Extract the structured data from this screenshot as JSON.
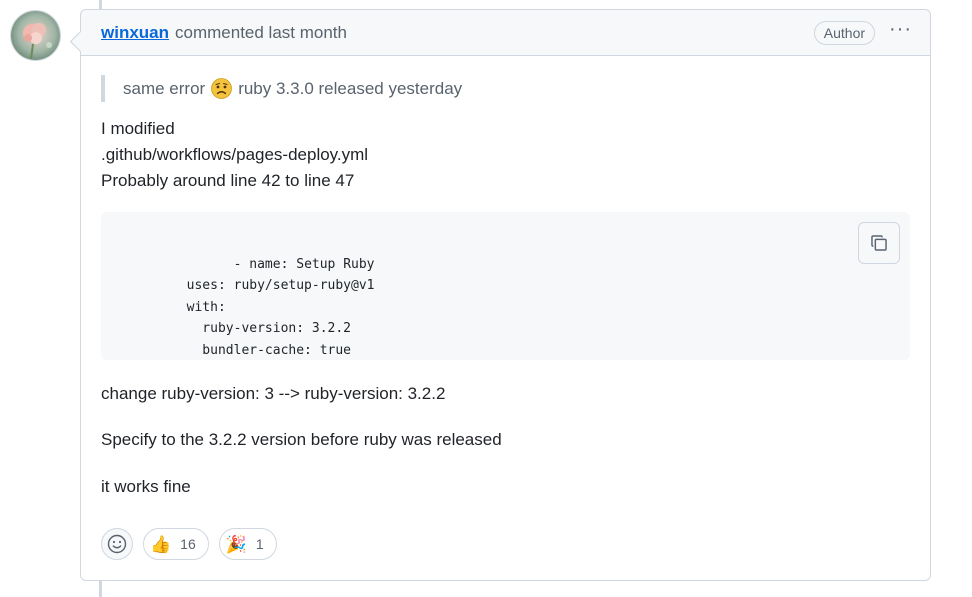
{
  "comment": {
    "author": "winxuan",
    "meta": "commented last month",
    "role_badge": "Author",
    "more_label": "···",
    "quote": {
      "before": "same error",
      "emoji": "sad-face-emoji",
      "after": "ruby 3.3.0 released yesterday"
    },
    "lines": [
      "I modified",
      ".github/workflows/pages-deploy.yml",
      "Probably around line 42 to line 47"
    ],
    "code": "- name: Setup Ruby\n  uses: ruby/setup-ruby@v1\n  with:\n    ruby-version: 3.2.2\n    bundler-cache: true",
    "paragraphs": [
      "change ruby-version: 3 --> ruby-version: 3.2.2",
      "Specify to the 3.2.2 version before ruby was released",
      "it works fine"
    ],
    "reactions": [
      {
        "emoji": "👍",
        "icon": "thumbs-up-icon",
        "count": "16"
      },
      {
        "emoji": "🎉",
        "icon": "tada-icon",
        "count": "1"
      }
    ]
  },
  "colors": {
    "link": "#0969da",
    "muted": "#59636e",
    "border": "#d0d7de",
    "header_bg": "#f6f8fa"
  }
}
